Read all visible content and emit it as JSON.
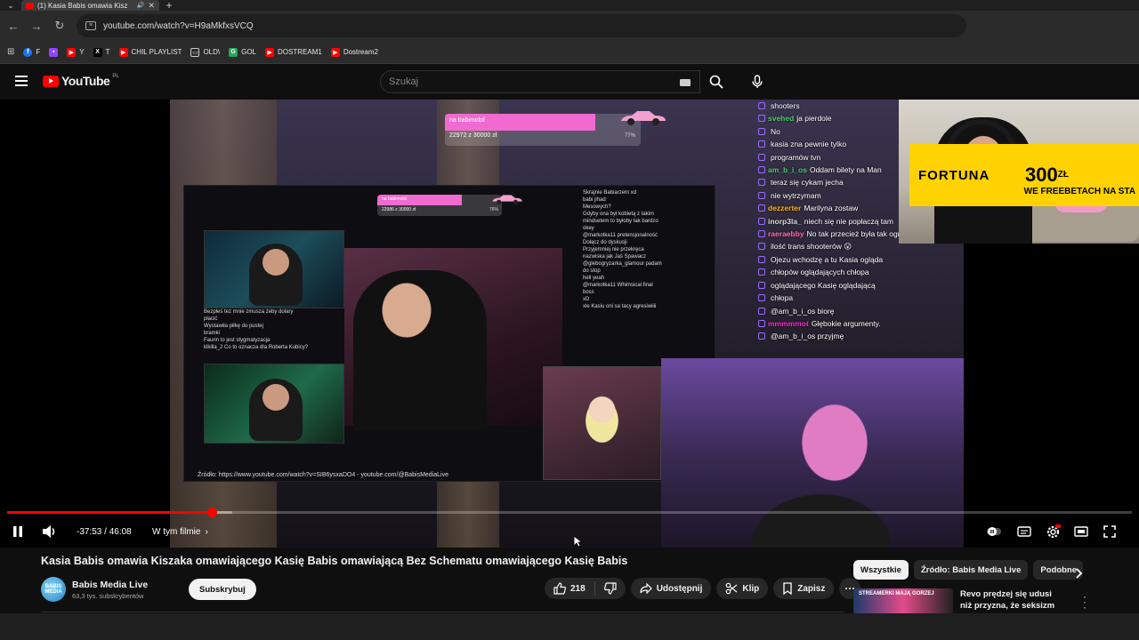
{
  "browser": {
    "tab_title": "(1) Kasia Babis omawia Kisz",
    "url": "youtube.com/watch?v=H9aMkfxsVCQ",
    "bookmarks": [
      {
        "label": "F",
        "icon": "facebook-icon",
        "color": "#1877f2"
      },
      {
        "label": "",
        "icon": "twitch-icon",
        "color": "#9146ff"
      },
      {
        "label": "Y",
        "icon": "youtube-icon",
        "color": "#ff0000"
      },
      {
        "label": "T",
        "icon": "x-icon",
        "color": "#000000"
      },
      {
        "label": "CHIL PLAYLIST",
        "icon": "youtube-icon",
        "color": "#ff0000"
      },
      {
        "label": "OLD\\",
        "icon": "folder-icon",
        "color": "#2b2b2b"
      },
      {
        "label": "GOL",
        "icon": "gol-icon",
        "color": "#27a35a"
      },
      {
        "label": "DOSTREAM1",
        "icon": "youtube-icon",
        "color": "#ff0000"
      },
      {
        "label": "Dostream2",
        "icon": "youtube-icon",
        "color": "#ff0000"
      }
    ]
  },
  "masthead": {
    "logo_text": "YouTube",
    "country_code": "PL",
    "search_placeholder": "Szukaj"
  },
  "player": {
    "progress_fraction": 0.182,
    "buffer_fraction": 0.2,
    "time_display": "-37:53 / 46:08",
    "chapter_label": "W tym filmie",
    "in_video": {
      "donation_label": "na babimobil",
      "donation_amount": "22972 z 30000 zł",
      "donation_percent": "77%",
      "donation_fraction": 0.77,
      "inner_donation_label": "na babimobil",
      "inner_donation_amount": "22986 z 30000 zł",
      "inner_donation_percent": "76%",
      "source_line": "Źródło: https://www.youtube.com/watch?v=SIB6ysxaDO4 - youtube.com/@BabisMediaLive",
      "inner_chat": [
        "Skrajnie Babiarzem xd",
        "babi jihad",
        "Mesowych?",
        "Gdyby ona był kobietą z takim",
        "mindsetem to byłoby tak bardzo",
        "okey",
        "@markotka11 pretensjonalność",
        "Dołącz do dyskusji",
        "Przyjemniej nie przekręca",
        "nazwiska jak Jaś Spawacz",
        "@glebogryzarka_glamour padam",
        "do stop",
        "hell yeah",
        "@markotka11 Whimsical final",
        "boss",
        "xD",
        "xle Kasiu oni sa tacy agresiwiiii"
      ],
      "inner_chat_left": [
        "Bezpłeś też mnie zmusza żeby dolary",
        "płacić",
        "Wystawiła piłkę do pustej",
        "bramki",
        "Faurin  to jest stygmatyzacja",
        "klkilla_2  Co to oznacza dla Roberta Kubicy?"
      ],
      "chat": [
        {
          "user": "",
          "msg": "shooters",
          "color": "#ffffff"
        },
        {
          "user": "svehed",
          "msg": "ja pierdole",
          "color": "#4fd16c"
        },
        {
          "user": "",
          "msg": "No",
          "color": "#4fd16c"
        },
        {
          "user": "",
          "msg": "kasia zna pewnie tylko",
          "color": "#9b59ff"
        },
        {
          "user": "",
          "msg": "programów tvn",
          "color": "#ffffff"
        },
        {
          "user": "am_b_i_os",
          "msg": "Oddam bilety na Man",
          "color": "#4fd16c"
        },
        {
          "user": "",
          "msg": "teraz się cykam jecha",
          "color": "#ffffff"
        },
        {
          "user": "",
          "msg": "nie wytrzymam",
          "color": "#2a8cff"
        },
        {
          "user": "dezzerter",
          "msg": "Marilyna zostaw",
          "color": "#ffb020"
        },
        {
          "user": "inorp3la_",
          "msg": "niech się nie popłaczą tam",
          "color": "#dddddd"
        },
        {
          "user": "raeraebby",
          "msg": "No tak przecież była tak ogromna",
          "color": "#ff6fb4"
        },
        {
          "user": "",
          "msg": "ilość trans shooterów 😮",
          "color": "#ffffff"
        },
        {
          "user": "",
          "msg": "Ojezu wchodzę a tu Kasia ogląda",
          "color": "#ff2a4d"
        },
        {
          "user": "",
          "msg": "chłopów oglądających chłopa",
          "color": "#ffffff"
        },
        {
          "user": "",
          "msg": "oglądającego Kasię oglądającą",
          "color": "#ffffff"
        },
        {
          "user": "",
          "msg": "chłopa",
          "color": "#ffffff"
        },
        {
          "user": "",
          "msg": "@am_b_i_os biorę",
          "color": "#9b59ff"
        },
        {
          "user": "mmmmmot",
          "msg": "Głębokie argumenty.",
          "color": "#ff2ad0"
        },
        {
          "user": "",
          "msg": "@am_b_i_os przyjmę",
          "color": "#9b59ff"
        }
      ]
    },
    "sponsor": {
      "brand": "FORTUNA",
      "amount": "300",
      "currency": "ZŁ",
      "tagline": "WE FREEBETACH NA STA"
    }
  },
  "video": {
    "title": "Kasia Babis omawia Kiszaka omawiającego Kasię Babis omawiającą Bez Schematu omawiającego Kasię Babis",
    "channel_name": "Babis Media Live",
    "channel_avatar_text": "BABIS MEDIA",
    "subscribers": "63,3 tys. subskrybentów",
    "subscribe_label": "Subskrybuj",
    "like_count": "218",
    "share_label": "Udostępnij",
    "clip_label": "Klip",
    "save_label": "Zapisz"
  },
  "sidebar": {
    "chips": [
      "Wszystkie",
      "Źródło: Babis Media Live",
      "Podobne"
    ],
    "recommendation": {
      "thumb_text": "STREAMERKI MAJĄ GORZEJ",
      "title": "Revo prędzej się udusi niż przyzna, że seksizm istnieje"
    }
  }
}
